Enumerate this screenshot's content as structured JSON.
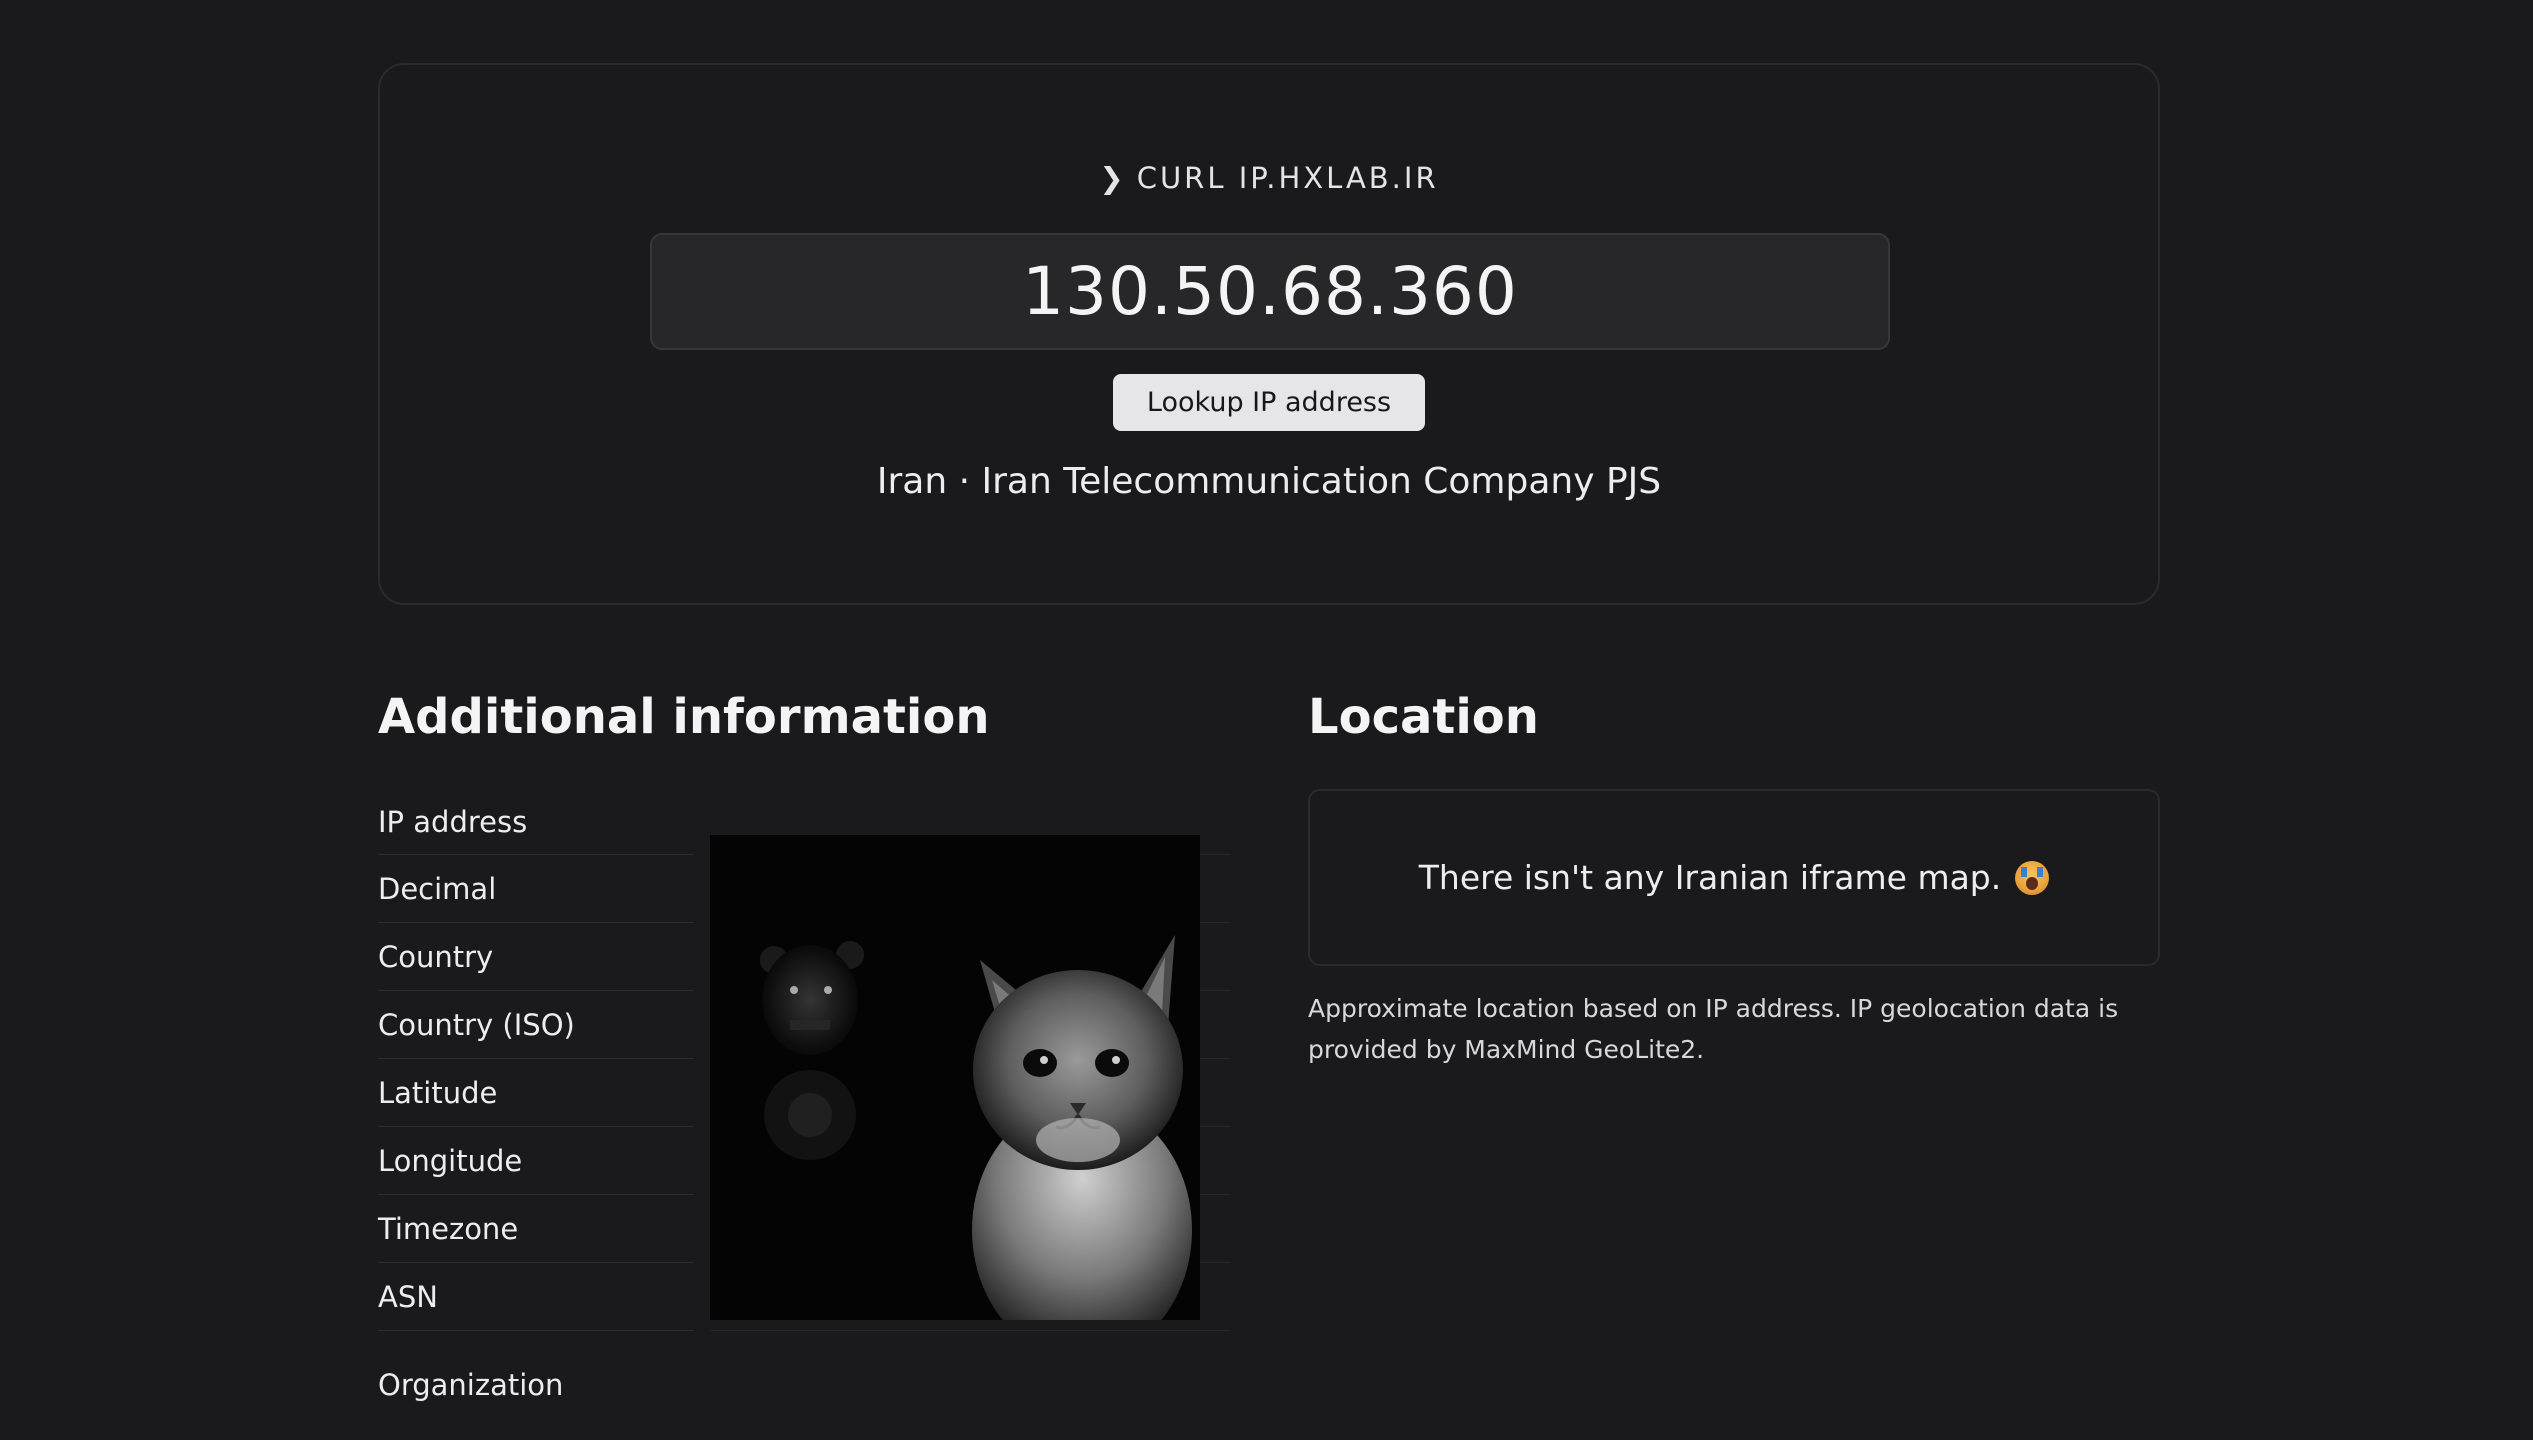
{
  "hero": {
    "command_prefix": "❯",
    "command": "CURL IP.HXLAB.IR",
    "ip": "130.50.68.360",
    "lookup_label": "Lookup IP address",
    "summary": "Iran · Iran Telecommunication Company PJS"
  },
  "additional": {
    "title": "Additional information",
    "rows": [
      "IP address",
      "Decimal",
      "Country",
      "Country (ISO)",
      "Latitude",
      "Longitude",
      "Timezone",
      "ASN"
    ],
    "organization": "Organization"
  },
  "location": {
    "title": "Location",
    "map_message": "There isn't any Iranian iframe map.",
    "emoji_name": "face-screaming-emoji",
    "note": "Approximate location based on IP address. IP geolocation data is provided by MaxMind GeoLite2."
  }
}
